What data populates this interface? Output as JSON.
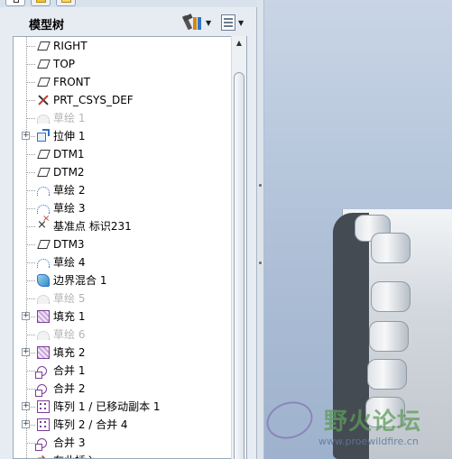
{
  "navigator": {
    "title": "模型树"
  },
  "tree": [
    {
      "label": "RIGHT",
      "icon": "datum-plane-icon",
      "expandable": false,
      "dimmed": false
    },
    {
      "label": "TOP",
      "icon": "datum-plane-icon",
      "expandable": false,
      "dimmed": false
    },
    {
      "label": "FRONT",
      "icon": "datum-plane-icon",
      "expandable": false,
      "dimmed": false
    },
    {
      "label": "PRT_CSYS_DEF",
      "icon": "coordinate-system-icon",
      "expandable": false,
      "dimmed": false
    },
    {
      "label": "草绘 1",
      "icon": "sketch-icon",
      "expandable": false,
      "dimmed": true
    },
    {
      "label": "拉伸 1",
      "icon": "extrude-icon",
      "expandable": true,
      "dimmed": false
    },
    {
      "label": "DTM1",
      "icon": "datum-plane-icon",
      "expandable": false,
      "dimmed": false
    },
    {
      "label": "DTM2",
      "icon": "datum-plane-icon",
      "expandable": false,
      "dimmed": false
    },
    {
      "label": "草绘 2",
      "icon": "sketch-icon",
      "expandable": false,
      "dimmed": false
    },
    {
      "label": "草绘 3",
      "icon": "sketch-icon",
      "expandable": false,
      "dimmed": false
    },
    {
      "label": "基准点 标识231",
      "icon": "datum-point-icon",
      "expandable": false,
      "dimmed": false
    },
    {
      "label": "DTM3",
      "icon": "datum-plane-icon",
      "expandable": false,
      "dimmed": false
    },
    {
      "label": "草绘 4",
      "icon": "sketch-icon",
      "expandable": false,
      "dimmed": false
    },
    {
      "label": "边界混合 1",
      "icon": "boundary-blend-icon",
      "expandable": false,
      "dimmed": false
    },
    {
      "label": "草绘 5",
      "icon": "sketch-icon",
      "expandable": false,
      "dimmed": true
    },
    {
      "label": "填充 1",
      "icon": "fill-icon",
      "expandable": true,
      "dimmed": false
    },
    {
      "label": "草绘 6",
      "icon": "sketch-icon",
      "expandable": false,
      "dimmed": true
    },
    {
      "label": "填充 2",
      "icon": "fill-icon",
      "expandable": true,
      "dimmed": false
    },
    {
      "label": "合并 1",
      "icon": "merge-icon",
      "expandable": false,
      "dimmed": false
    },
    {
      "label": "合并 2",
      "icon": "merge-icon",
      "expandable": false,
      "dimmed": false
    },
    {
      "label": "阵列 1 / 已移动副本 1",
      "icon": "pattern-icon",
      "expandable": true,
      "dimmed": false
    },
    {
      "label": "阵列 2 / 合并 4",
      "icon": "pattern-icon",
      "expandable": true,
      "dimmed": false
    },
    {
      "label": "合并 3",
      "icon": "merge-icon",
      "expandable": false,
      "dimmed": false
    },
    {
      "label": "在此插入",
      "icon": "insert-here-icon",
      "expandable": false,
      "dimmed": false
    }
  ],
  "watermark": {
    "text_cn": "野火论坛",
    "url": "www.proewildfire.cn"
  }
}
